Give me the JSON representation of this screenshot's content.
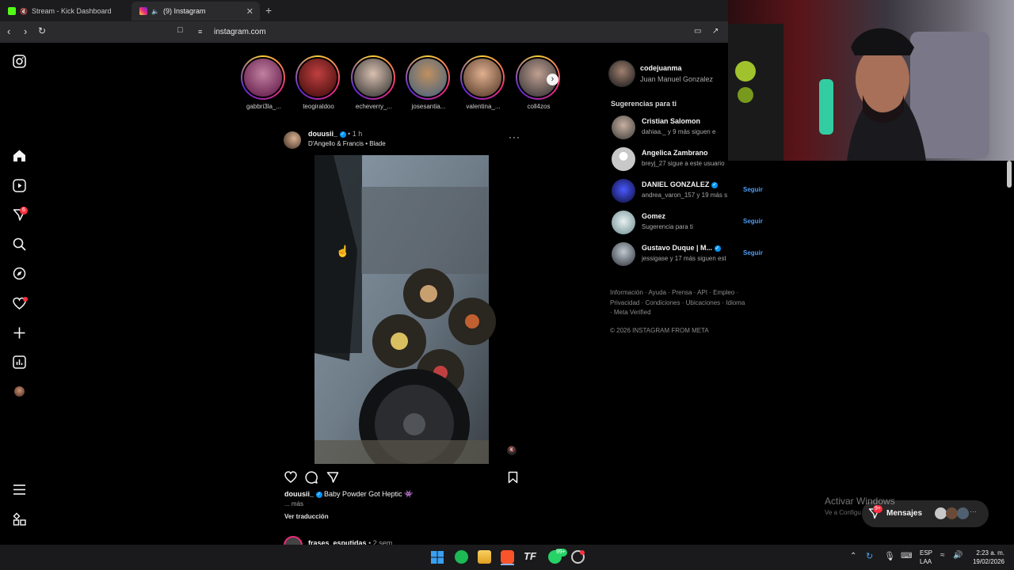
{
  "browser": {
    "tabs": [
      {
        "title": "Stream - Kick Dashboard",
        "active": false
      },
      {
        "title": "(9) Instagram",
        "active": true
      }
    ],
    "new_tab_icon": "plus-icon",
    "url": "instagram.com"
  },
  "left_nav": {
    "items": [
      "instagram-logo",
      "home-icon",
      "reels-icon",
      "messages-icon",
      "search-icon",
      "explore-icon",
      "notifications-icon",
      "create-icon",
      "dashboard-icon",
      "profile-avatar",
      "menu-icon",
      "also-from-meta-icon"
    ],
    "messages_badge": "6"
  },
  "stories": [
    {
      "name": "gabbri3la_...",
      "color": "#8a3060"
    },
    {
      "name": "teogiraldoo",
      "color": "#7a1a1a"
    },
    {
      "name": "echeverry_...",
      "color": "#3a3a3a"
    },
    {
      "name": "josesantia...",
      "color": "#6a5a40"
    },
    {
      "name": "valentina_...",
      "color": "#6a4a38"
    },
    {
      "name": "coll4zos",
      "color": "#3a3a40"
    }
  ],
  "post": {
    "username": "douusii_",
    "time": "1 h",
    "audio": "D'Angello & Francis • Blade",
    "caption_user": "douusii_",
    "caption": "Baby Powder Got Heptic 👾",
    "more": "... más",
    "translate": "Ver traducción",
    "next_user": "frases_esputidas",
    "next_time": "2 sem"
  },
  "sidebar": {
    "user_handle": "codejuanma",
    "user_name": "Juan Manuel Gonzalez",
    "suggestions_title": "Sugerencias para ti",
    "suggestions": [
      {
        "name": "Cristian Salomon",
        "sub": "dahiaa._ y 9 más siguen e",
        "follow": "",
        "verified": false
      },
      {
        "name": "Angelica Zambrano",
        "sub": "breyj_27 sigue a este usuario",
        "follow": "Seguir",
        "verified": false
      },
      {
        "name": "DANIEL GONZALEZ",
        "sub": "andrea_varon_157 y 19 más s",
        "follow": "Seguir",
        "verified": true
      },
      {
        "name": "Gomez",
        "sub": "Sugerencia para ti",
        "follow": "Seguir",
        "verified": false
      },
      {
        "name": "Gustavo Duque | M...",
        "sub": "jessigase y 17 más siguen est",
        "follow": "Seguir",
        "verified": true
      }
    ],
    "footer_links": "Información · Ayuda · Prensa · API · Empleo · Privacidad · Condiciones · Ubicaciones · Idioma · Meta Verified",
    "copyright": "© 2026 INSTAGRAM FROM META"
  },
  "messages_bar": {
    "label": "Mensajes",
    "badge": "9+"
  },
  "watermark": {
    "title": "Activar Windows",
    "sub": "Ve a Configuración para activar Windows."
  },
  "taskbar": {
    "lang": "ESP",
    "region": "LAA",
    "time": "2:23 a. m.",
    "date": "19/02/2026",
    "whatsapp_badge": "99+"
  }
}
